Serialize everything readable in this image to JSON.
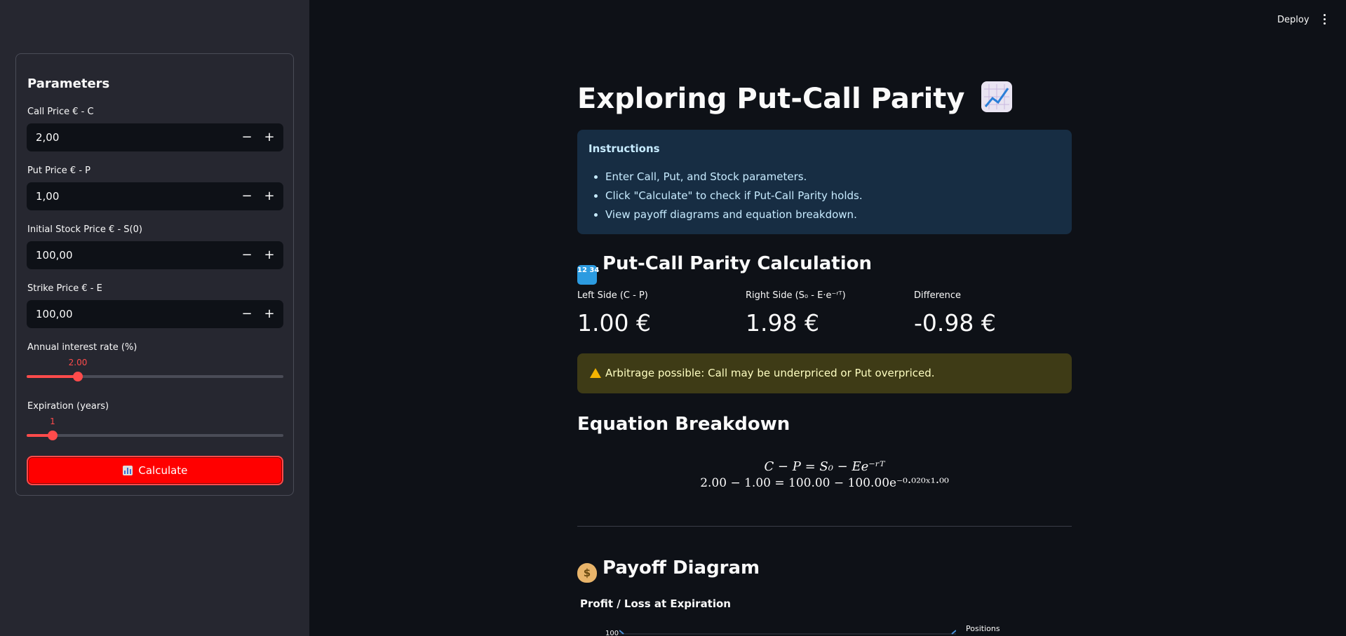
{
  "sidebar": {
    "title": "Parameters",
    "call_price": {
      "label": "Call Price € - C",
      "value": "2,00"
    },
    "put_price": {
      "label": "Put Price € - P",
      "value": "1,00"
    },
    "stock_price": {
      "label": "Initial Stock Price € - S(0)",
      "value": "100,00"
    },
    "strike_price": {
      "label": "Strike Price € - E",
      "value": "100,00"
    },
    "interest_rate": {
      "label": "Annual interest rate (%)",
      "value": "2.00",
      "level": 0.2
    },
    "expiration": {
      "label": "Expiration (years)",
      "value": "1",
      "level": 0.1
    },
    "minus_glyph": "−",
    "plus_glyph": "+",
    "calculate_label": "Calculate",
    "calculate_icon": "bar-chart-icon"
  },
  "header": {
    "deploy_label": "Deploy",
    "menu_icon": "kebab-menu-icon"
  },
  "main": {
    "title": "Exploring Put-Call Parity",
    "title_icon": "chart-increasing-icon",
    "instructions": {
      "title": "Instructions",
      "items": [
        "Enter Call, Put, and Stock parameters.",
        "Click \"Calculate\" to check if Put-Call Parity holds.",
        "View payoff diagrams and equation breakdown."
      ]
    },
    "calc_section": {
      "title": "Put-Call Parity Calculation",
      "icon": "numbers-icon",
      "icon_text": "12 34",
      "metrics": [
        {
          "label": "Left Side (C - P)",
          "value": "1.00 €"
        },
        {
          "label": "Right Side (S₀ - E·e⁻ʳᵀ)",
          "value": "1.98 €"
        },
        {
          "label": "Difference",
          "value": "-0.98 €"
        }
      ]
    },
    "warning": {
      "icon": "warning-icon",
      "text": "Arbitrage possible: Call may be underpriced or Put overpriced."
    },
    "equation": {
      "title": "Equation Breakdown",
      "line1": "C − P = S₀ − Ee⁻ʳᵀ",
      "line2": "2.00 − 1.00 = 100.00 − 100.00e⁻⁰·⁰²⁰ˣ¹·⁰⁰"
    },
    "payoff": {
      "title": "Payoff Diagram",
      "icon": "money-bag-icon",
      "chart_title": "Profit / Loss at Expiration",
      "y_tick": "100",
      "legend_title": "Positions"
    },
    "colors": {
      "accent": "#ff4b4b",
      "button": "#ff0000",
      "info_bg": "#172d43",
      "warn_bg": "#3e3b16"
    }
  }
}
